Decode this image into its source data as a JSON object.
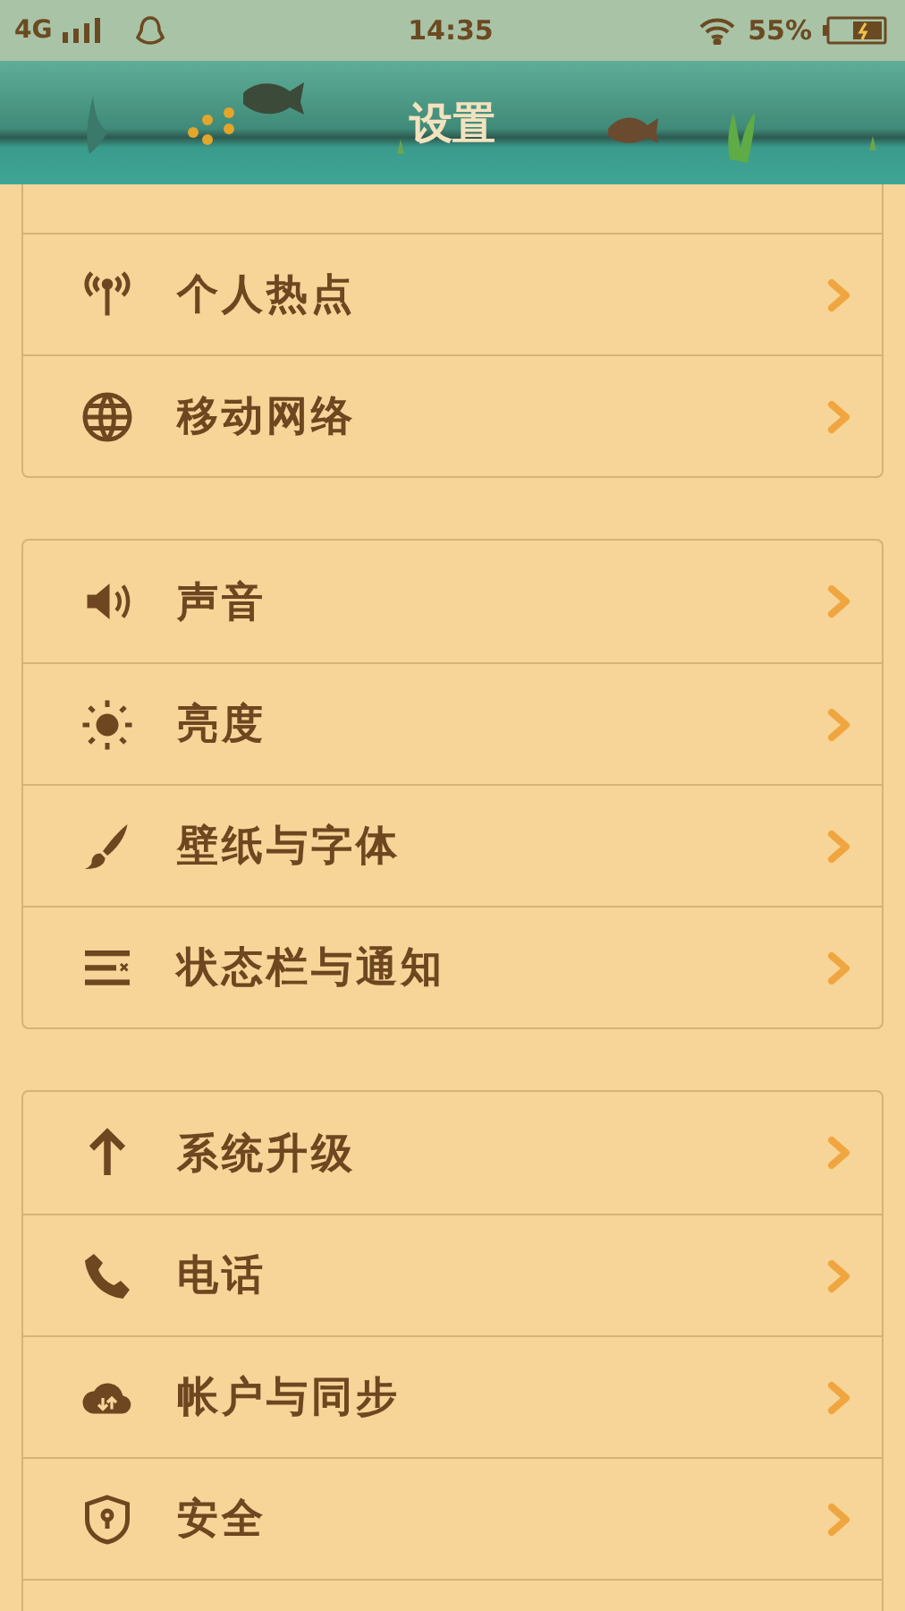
{
  "status_bar": {
    "network": "4G",
    "time": "14:35",
    "battery": "55%"
  },
  "header": {
    "title": "设置"
  },
  "groups": [
    {
      "items": [
        {
          "label": "个人热点"
        },
        {
          "label": "移动网络"
        }
      ]
    },
    {
      "items": [
        {
          "label": "声音"
        },
        {
          "label": "亮度"
        },
        {
          "label": "壁纸与字体"
        },
        {
          "label": "状态栏与通知"
        }
      ]
    },
    {
      "items": [
        {
          "label": "系统升级"
        },
        {
          "label": "电话"
        },
        {
          "label": "帐户与同步"
        },
        {
          "label": "安全"
        }
      ]
    }
  ]
}
